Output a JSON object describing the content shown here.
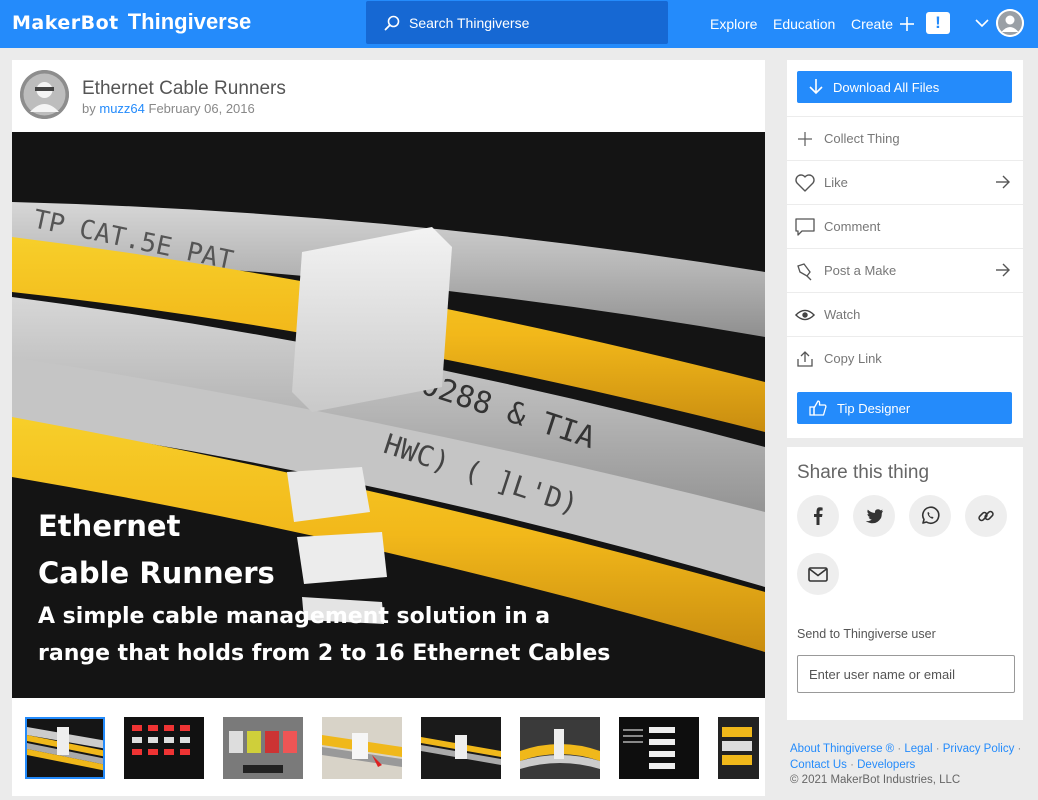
{
  "header": {
    "logo_maker": "MakerBot",
    "logo_thing": "Thingiverse",
    "search_placeholder": "Search Thingiverse",
    "nav": {
      "explore": "Explore",
      "education": "Education",
      "create": "Create"
    },
    "alert_glyph": "!",
    "icons": [
      "search-icon",
      "plus-icon",
      "chevron-down-icon",
      "user-avatar-icon"
    ]
  },
  "thing": {
    "title": "Ethernet Cable Runners",
    "by": "by",
    "author": "muzz64",
    "date": "February 06, 2016",
    "hero_text": {
      "line1": "Ethernet",
      "line2": "Cable Runners",
      "line3": "A simple cable management solution in a",
      "line4": "range that holds from 2 to 16 Ethernet Cables"
    },
    "thumbnail_count": 8,
    "active_thumbnail": 1
  },
  "actions": {
    "download": "Download All Files",
    "collect": "Collect Thing",
    "like": "Like",
    "comment": "Comment",
    "post_make": "Post a Make",
    "watch": "Watch",
    "copy_link": "Copy Link",
    "tip": "Tip Designer"
  },
  "share": {
    "title": "Share this thing",
    "targets": [
      "facebook-icon",
      "twitter-icon",
      "whatsapp-icon",
      "link-icon",
      "email-icon"
    ],
    "send_label": "Send to Thingiverse user",
    "send_placeholder": "Enter user name or email"
  },
  "footer": {
    "about": "About Thingiverse ®",
    "legal": "Legal",
    "privacy": "Privacy Policy",
    "contact": "Contact Us",
    "developers": "Developers",
    "copyright": "© 2021 MakerBot Industries, LLC"
  },
  "colors": {
    "brand": "#248bfb",
    "search_bg": "#1668d3",
    "page_bg": "#ebebeb"
  }
}
